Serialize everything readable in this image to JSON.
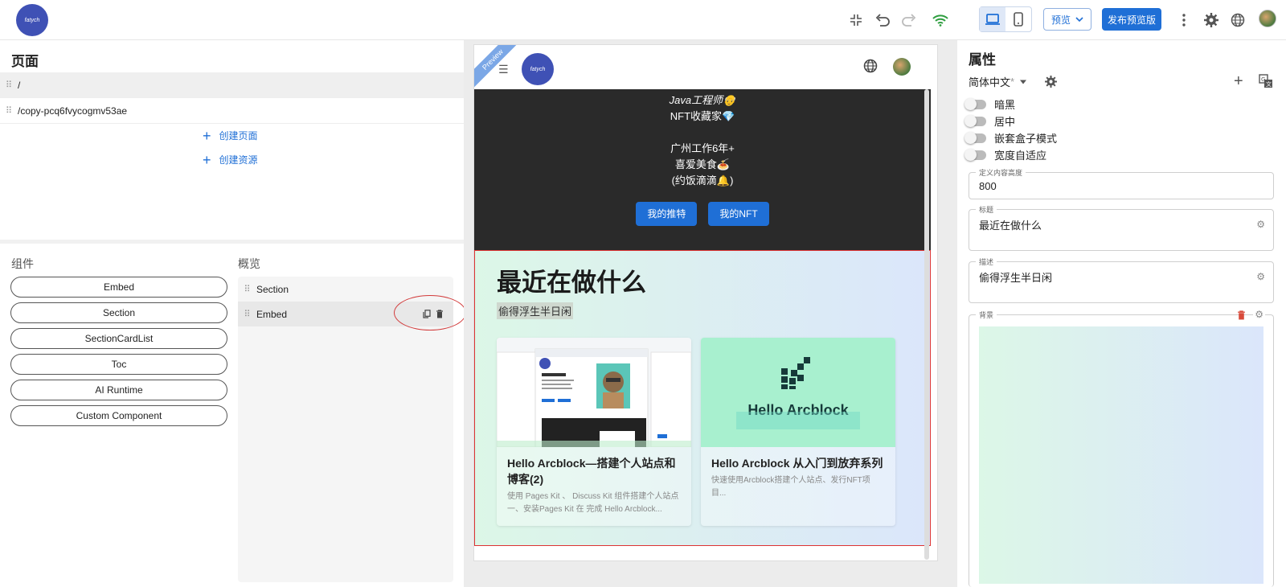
{
  "topbar": {
    "logo_text": "fatych",
    "preview_label": "预览",
    "publish_label": "发布预览版"
  },
  "pages_panel": {
    "title": "页面",
    "pages": [
      "/",
      "/copy-pcq6fvycogmv53ae"
    ],
    "create_page": "创建页面",
    "create_resource": "创建资源"
  },
  "components_panel": {
    "title": "组件",
    "items": [
      "Embed",
      "Section",
      "SectionCardList",
      "Toc",
      "AI Runtime",
      "Custom Component"
    ]
  },
  "overview_panel": {
    "title": "概览",
    "items": [
      "Section",
      "Embed"
    ]
  },
  "preview": {
    "ribbon": "Preview",
    "logo_text": "fatych",
    "bio_lines": [
      "Java工程师👴",
      "NFT收藏家💎",
      "",
      "广州工作6年+",
      "喜爱美食🍝",
      "(约饭滴滴🔔)"
    ],
    "buttons": [
      "我的推特",
      "我的NFT"
    ],
    "section_title": "最近在做什么",
    "section_desc": "偷得浮生半日闲",
    "cards": [
      {
        "title": "Hello Arcblock—搭建个人站点和博客(2)",
        "desc": "使用 Pages Kit 、 Discuss Kit 组件搭建个人站点 一、安装Pages Kit 在 完成 Hello Arcblock..."
      },
      {
        "title": "Hello Arcblock 从入门到放弃系列",
        "desc": "快速使用Arcblock搭建个人站点、发行NFT项目...",
        "image_text": "Hello Arcblock"
      }
    ]
  },
  "properties_panel": {
    "title": "属性",
    "language": "简体中文",
    "language_mark": "*",
    "switches": [
      "暗黑",
      "居中",
      "嵌套盒子模式",
      "宽度自适应"
    ],
    "height_label": "定义内容高度",
    "height_value": "800",
    "title_label": "标题",
    "title_value": "最近在做什么",
    "desc_label": "描述",
    "desc_value": "偷得浮生半日闲",
    "bg_label": "背景"
  },
  "colors": {
    "accent": "#1f6fd6",
    "highlight_border": "#d33333",
    "section_gradient_start": "#dcf7e7",
    "section_gradient_end": "#dbe6fb"
  }
}
